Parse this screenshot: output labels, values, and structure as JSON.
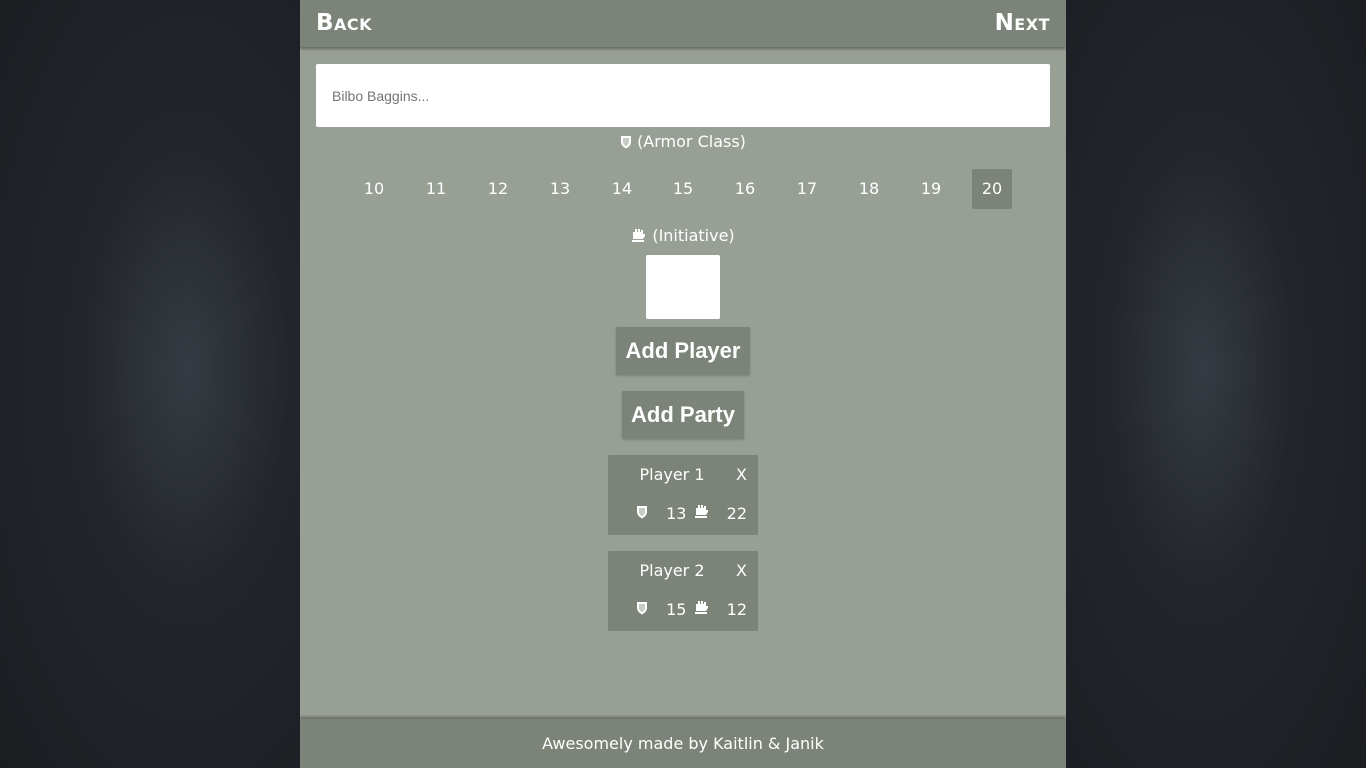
{
  "header": {
    "back_label": "Back",
    "next_label": "Next"
  },
  "name_input": {
    "placeholder": "Bilbo Baggins...",
    "value": ""
  },
  "armor_class": {
    "label": "(Armor Class)",
    "icon": "shield-icon",
    "options": [
      "10",
      "11",
      "12",
      "13",
      "14",
      "15",
      "16",
      "17",
      "18",
      "19",
      "20"
    ],
    "selected": "20"
  },
  "initiative": {
    "label": "(Initiative)",
    "icon": "hand-icon",
    "value": ""
  },
  "buttons": {
    "add_player": "Add Player",
    "add_party": "Add Party"
  },
  "players": [
    {
      "name": "Player 1",
      "armor_class": "13",
      "initiative": "22",
      "remove_label": "X"
    },
    {
      "name": "Player 2",
      "armor_class": "15",
      "initiative": "12",
      "remove_label": "X"
    }
  ],
  "footer": {
    "text": "Awesomely made by Kaitlin & Janik"
  },
  "colors": {
    "panel": "#98a096",
    "bar": "#7c8378",
    "background": "#1e2125"
  }
}
